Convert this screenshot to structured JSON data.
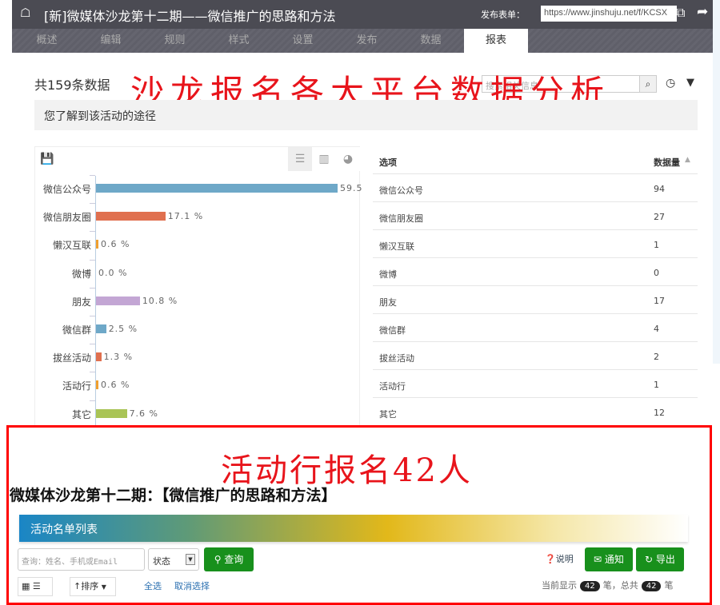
{
  "header": {
    "title": "[新]微媒体沙龙第十二期——微信推广的思路和方法",
    "publish_label": "发布表单：",
    "publish_url": "https://www.jinshuju.net/f/KCSX"
  },
  "nav": {
    "tabs": [
      "概述",
      "编辑",
      "规则",
      "样式",
      "设置",
      "发布",
      "数据",
      "报表"
    ],
    "active": "报表"
  },
  "report": {
    "count_label": "共159条数据",
    "search_placeholder": "搜索相关信息",
    "question": "您了解到该活动的途径"
  },
  "overlay": {
    "top_annotation": "沙龙报名各大平台数据分析",
    "bottom_annotation": "活动行报名42人"
  },
  "chart_data": {
    "type": "bar",
    "orientation": "horizontal",
    "categories": [
      "微信公众号",
      "微信朋友圈",
      "懒汉互联",
      "微博",
      "朋友",
      "微信群",
      "拔丝活动",
      "活动行",
      "其它"
    ],
    "values": [
      59.5,
      17.1,
      0.6,
      0.0,
      10.8,
      2.5,
      1.3,
      0.6,
      7.6
    ],
    "value_labels": [
      "59.5",
      "17.1 %",
      "0.6 %",
      "0.0 %",
      "10.8 %",
      "2.5 %",
      "1.3 %",
      "0.6 %",
      "7.6 %"
    ],
    "colors": [
      "#6ea8c8",
      "#e0704f",
      "#f0a030",
      "#999999",
      "#c3a6d4",
      "#6ea8c8",
      "#e0704f",
      "#f0a030",
      "#a9c456"
    ],
    "unit": "%"
  },
  "table": {
    "headers": [
      "选项",
      "数据量"
    ],
    "rows": [
      [
        "微信公众号",
        "94"
      ],
      [
        "微信朋友圈",
        "27"
      ],
      [
        "懒汉互联",
        "1"
      ],
      [
        "微博",
        "0"
      ],
      [
        "朋友",
        "17"
      ],
      [
        "微信群",
        "4"
      ],
      [
        "拔丝活动",
        "2"
      ],
      [
        "活动行",
        "1"
      ],
      [
        "其它",
        "12"
      ]
    ]
  },
  "event": {
    "title": "微媒体沙龙第十二期：【微信推广的思路和方法】",
    "banner": "活动名单列表",
    "query_placeholder": "查询：姓名、手机或Email",
    "status_label": "状态",
    "query_btn": "查询",
    "help": "说明",
    "notify_btn": "通知",
    "export_btn": "导出",
    "sort_btn": "排序",
    "select_all": "全选",
    "deselect": "取消选择",
    "showing_prefix": "当前显示",
    "showing_count": "42",
    "showing_mid": "笔，总共",
    "total_count": "42",
    "showing_suffix": "笔"
  }
}
